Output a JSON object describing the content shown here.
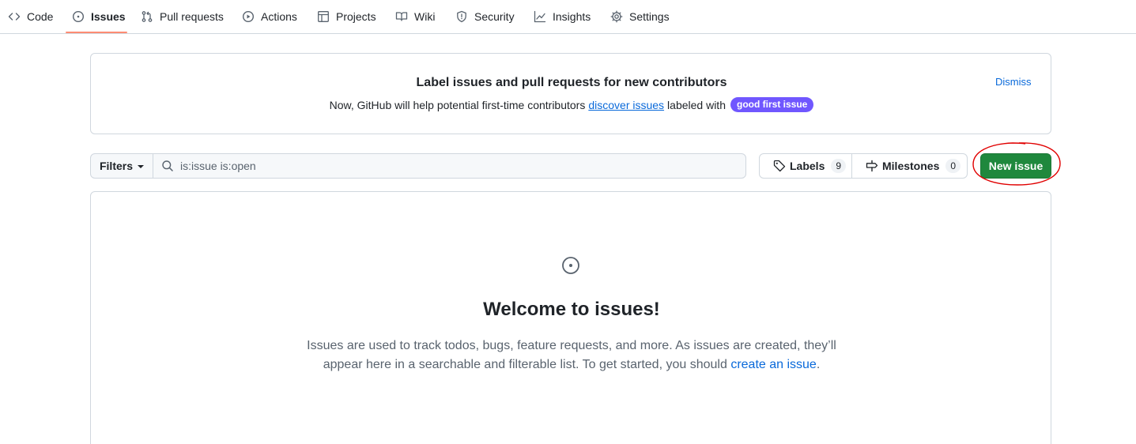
{
  "nav": {
    "tabs": [
      {
        "label": "Code",
        "icon": "code-icon"
      },
      {
        "label": "Issues",
        "icon": "issue-opened-icon",
        "active": true
      },
      {
        "label": "Pull requests",
        "icon": "git-pull-request-icon"
      },
      {
        "label": "Actions",
        "icon": "play-icon"
      },
      {
        "label": "Projects",
        "icon": "table-icon"
      },
      {
        "label": "Wiki",
        "icon": "book-icon"
      },
      {
        "label": "Security",
        "icon": "shield-icon"
      },
      {
        "label": "Insights",
        "icon": "graph-icon"
      },
      {
        "label": "Settings",
        "icon": "gear-icon"
      }
    ]
  },
  "banner": {
    "title": "Label issues and pull requests for new contributors",
    "text_before": "Now, GitHub will help potential first-time contributors",
    "link_text": "discover issues",
    "text_after": "labeled with",
    "label": "good first issue",
    "label_color": "#7057ff",
    "dismiss": "Dismiss"
  },
  "toolbar": {
    "filters_label": "Filters",
    "search_value": "is:issue is:open",
    "labels_label": "Labels",
    "labels_count": "9",
    "milestones_label": "Milestones",
    "milestones_count": "0",
    "new_issue_label": "New issue",
    "accent": "#1f883d"
  },
  "blankslate": {
    "title": "Welcome to issues!",
    "text_before": "Issues are used to track todos, bugs, feature requests, and more. As issues are created, they’ll appear here in a searchable and filterable list. To get started, you should",
    "link_text": "create an issue",
    "text_after": "."
  },
  "colors": {
    "link": "#0969da",
    "annotation": "#e00000"
  }
}
